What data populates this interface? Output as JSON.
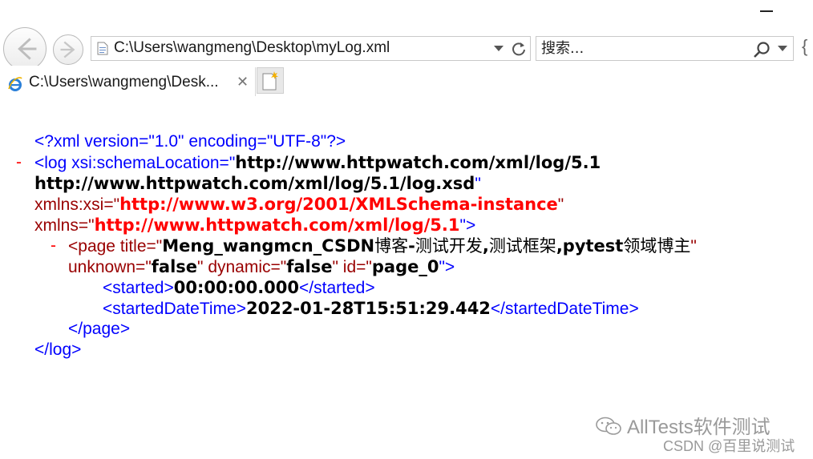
{
  "address": {
    "url": "C:\\Users\\wangmeng\\Desktop\\myLog.xml"
  },
  "search": {
    "placeholder": "搜索..."
  },
  "tab": {
    "title": "C:\\Users\\wangmeng\\Desk...",
    "close_glyph": "✕"
  },
  "xml": {
    "decl": "<?xml version=\"1.0\" encoding=\"UTF-8\"?>",
    "toggle_minus": "-",
    "log_open_pre": "<log xsi:schemaLocation=\"",
    "schema_location_1": "http://www.httpwatch.com/xml/log/5.1",
    "schema_location_2": "http://www.httpwatch.com/xml/log/5.1/log.xsd",
    "quote": "\"",
    "xmlns_xsi_attr": "xmlns:xsi=\"",
    "xmlns_xsi_value": "http://www.w3.org/2001/XMLSchema-instance",
    "xmlns_attr": "xmlns=\"",
    "xmlns_value": "http://www.httpwatch.com/xml/log/5.1",
    "close_quote_gt": "\">",
    "page_open_pre": "<page title=\"",
    "page_title_latin": "Meng_wangmcn_CSDN",
    "page_title_cjk1": "博客",
    "page_title_dash": "-",
    "page_title_cjk2": "测试开发",
    "page_title_comma1": ",",
    "page_title_cjk3": "测试框架",
    "page_title_comma2": ",",
    "page_title_pytest": "pytest",
    "page_title_cjk4": "领域博主",
    "unknown_attr": "unknown=\"",
    "unknown_value": "false",
    "dynamic_attr": "\" dynamic=\"",
    "dynamic_value": "false",
    "id_attr": "\" id=\"",
    "id_value": "page_0",
    "started_open": "<started>",
    "started_value": "00:00:00.000",
    "started_close": "</started>",
    "started_dt_open": "<startedDateTime>",
    "started_dt_value": "2022-01-28T15:51:29.442",
    "started_dt_close": "</startedDateTime>",
    "page_close": "</page>",
    "log_close": "</log>"
  },
  "watermark": {
    "line1": "AllTests软件测试",
    "line2": "CSDN @百里说测试"
  },
  "colors": {
    "tag": "#0000ff",
    "attr": "#990000",
    "ns_value": "#ff0000",
    "value": "#000000"
  }
}
